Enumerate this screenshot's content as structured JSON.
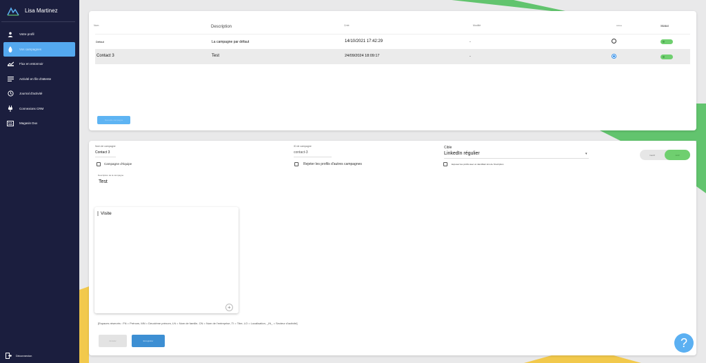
{
  "sidebar": {
    "user_name": "Lisa Martinez",
    "items": [
      {
        "label": "Votre profil",
        "icon": "person-icon"
      },
      {
        "label": "Vos campagnes",
        "icon": "campaign-icon"
      },
      {
        "label": "Flux en entonnoir",
        "icon": "funnel-icon"
      },
      {
        "label": "Activité en file d'attente",
        "icon": "queue-icon"
      },
      {
        "label": "Journal d'activité",
        "icon": "history-icon"
      },
      {
        "label": "Connexions CRM",
        "icon": "plug-icon"
      },
      {
        "label": "Magasin Dux",
        "icon": "store-icon"
      }
    ],
    "logout": "Déconnexion"
  },
  "campaigns": {
    "headers": {
      "name": "Nom",
      "description": "Description",
      "created": "Créé",
      "modified": "Modifié",
      "active": "Active",
      "status": "Statut"
    },
    "rows": [
      {
        "name": "Défaut",
        "description": "La campagne par défaut",
        "created": "14/10/2021 17:42:29",
        "modified": "-",
        "selected": false
      },
      {
        "name": "Contact 3",
        "description": "Test",
        "created": "24/09/2024 18:09:17",
        "modified": "-",
        "selected": true
      }
    ],
    "new_button": "Nouvelle campagne"
  },
  "form": {
    "name_label": "Nom de campagne",
    "name_value": "Contact 3",
    "id_label": "ID de campagne",
    "id_value": "contact-3",
    "target_label": "Cible",
    "target_value": "LinkedIn régulier",
    "team_campaign": "Campagne d'équipe",
    "reject_profiles": "Rejeter les profils d'autres campagnes",
    "skip_profiles": "Exposez les profils avec un identifiant lors de l'inscription",
    "description_label": "Description de la campagne",
    "description_value": "Test",
    "toggle_off": "Inactif",
    "toggle_on": "Actif",
    "editor_step": "Visite",
    "hint": "[Espaces réservés : FN = Prénom, MN = Deuxième prénom, LN = Nom de famille, CN = Nom de l'entreprise, TI = Titre, LO = Localisation, _IN_ = Secteur d'activité]",
    "cancel_button": "Annuler",
    "save_button": "Enregistrer"
  },
  "help_label": "?",
  "colors": {
    "sidebar": "#1b1e3e",
    "accent": "#54a8ef",
    "green": "#6fcf6f",
    "yellow": "#f2c94c"
  }
}
